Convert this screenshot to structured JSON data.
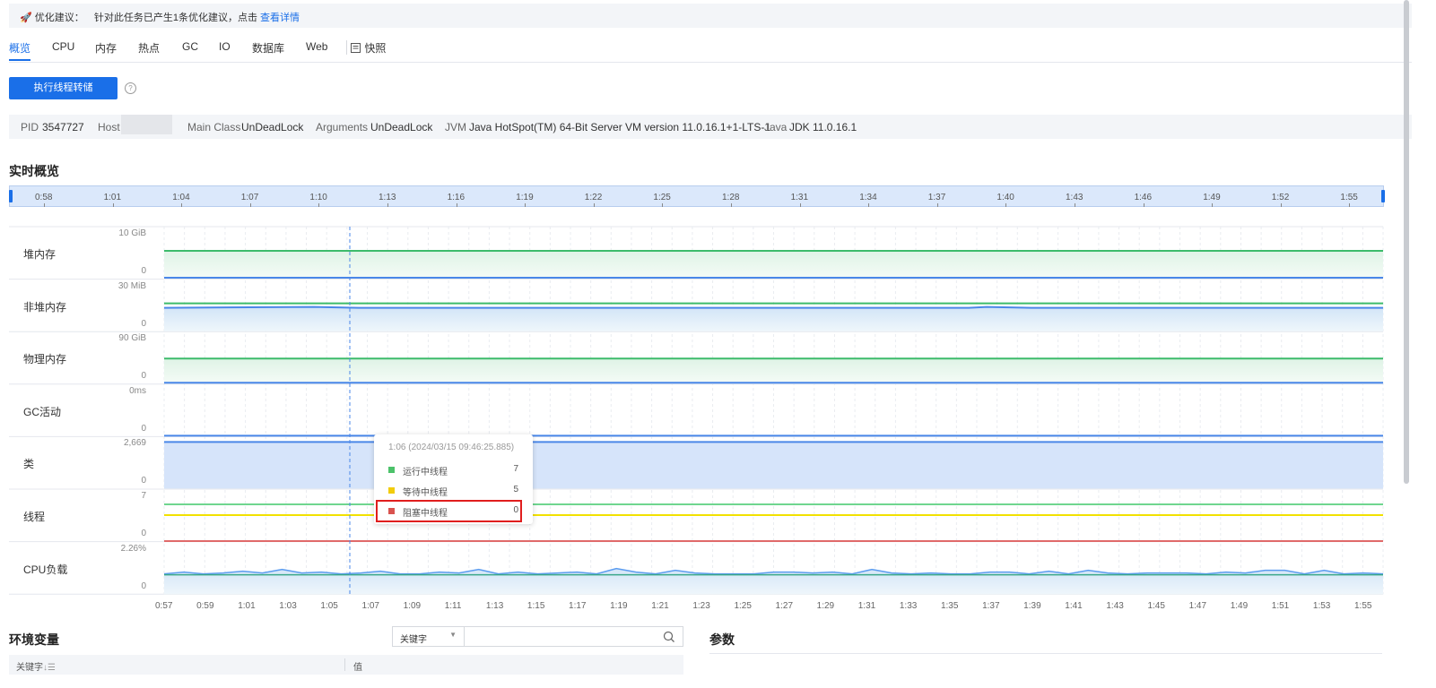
{
  "banner": {
    "icon": "rocket-icon",
    "label": "优化建议：",
    "message": "针对此任务已产生1条优化建议，点击",
    "link": "查看详情"
  },
  "tabs": [
    {
      "label": "概览",
      "active": true
    },
    {
      "label": "CPU"
    },
    {
      "label": "内存"
    },
    {
      "label": "热点"
    },
    {
      "label": "GC"
    },
    {
      "label": "IO"
    },
    {
      "label": "数据库"
    },
    {
      "label": "Web"
    },
    {
      "label": "快照",
      "icon": "snapshot-icon"
    }
  ],
  "actions": {
    "dump_button": "执行线程转储"
  },
  "jvm_info": {
    "pid_label": "PID",
    "pid": "3547727",
    "host_label": "Host",
    "main_class_label": "Main Class",
    "main_class": "UnDeadLock",
    "arguments_label": "Arguments",
    "arguments": "UnDeadLock",
    "jvm_label": "JVM",
    "jvm": "Java HotSpot(TM) 64-Bit Server VM version 11.0.16.1+1-LTS-1",
    "java_label": "Java",
    "java": "JDK 11.0.16.1"
  },
  "overview_title": "实时概览",
  "range_slider": {
    "ticks": [
      "0:58",
      "1:01",
      "1:04",
      "1:07",
      "1:10",
      "1:13",
      "1:16",
      "1:19",
      "1:22",
      "1:25",
      "1:28",
      "1:31",
      "1:34",
      "1:37",
      "1:40",
      "1:43",
      "1:46",
      "1:49",
      "1:52",
      "1:55"
    ]
  },
  "metrics": [
    {
      "label": "堆内存",
      "ymax": "10 GiB",
      "ymin": "0"
    },
    {
      "label": "非堆内存",
      "ymax": "30 MiB",
      "ymin": "0"
    },
    {
      "label": "物理内存",
      "ymax": "90 GiB",
      "ymin": "0"
    },
    {
      "label": "GC活动",
      "ymax": "0ms",
      "ymin": "0"
    },
    {
      "label": "类",
      "ymax": "2,669",
      "ymin": "0"
    },
    {
      "label": "线程",
      "ymax": "7",
      "ymin": "0"
    },
    {
      "label": "CPU负载",
      "ymax": "2.26%",
      "ymin": "0"
    }
  ],
  "x_ticks": [
    "0:57",
    "0:59",
    "1:01",
    "1:03",
    "1:05",
    "1:07",
    "1:09",
    "1:11",
    "1:13",
    "1:15",
    "1:17",
    "1:19",
    "1:21",
    "1:23",
    "1:25",
    "1:27",
    "1:29",
    "1:31",
    "1:33",
    "1:35",
    "1:37",
    "1:39",
    "1:41",
    "1:43",
    "1:45",
    "1:47",
    "1:49",
    "1:51",
    "1:53",
    "1:55"
  ],
  "tooltip": {
    "title": "1:06 (2024/03/15 09:46:25.885)",
    "rows": [
      {
        "name": "运行中线程",
        "value": "7",
        "color": "#4cc26a"
      },
      {
        "name": "等待中线程",
        "value": "5",
        "color": "#f2cc0c"
      },
      {
        "name": "阻塞中线程",
        "value": "0",
        "color": "#d9534f"
      }
    ]
  },
  "env": {
    "title": "环境变量",
    "select_value": "关键字",
    "col_key": "关键字",
    "col_value": "值"
  },
  "params": {
    "title": "参数"
  },
  "colors": {
    "accent": "#1a6fe8",
    "green": "#4cc26a",
    "blue": "#5b8ff9",
    "yellow": "#f2e100",
    "red": "#e06a6a"
  }
}
